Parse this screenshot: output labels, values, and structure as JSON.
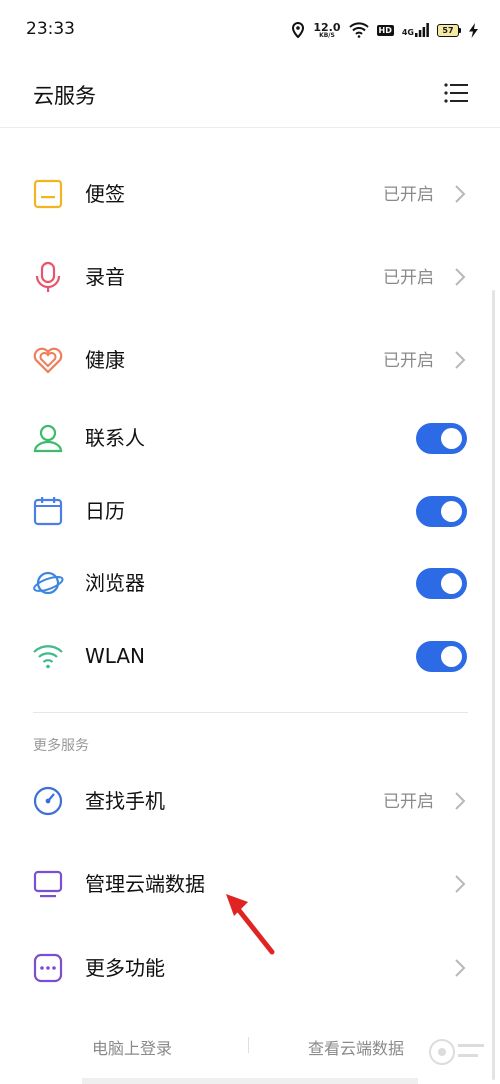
{
  "status_bar": {
    "time": "23:33",
    "net_speed_value": "12.0",
    "net_speed_unit": "KB/S",
    "hd_label": "HD",
    "network_label": "4G",
    "battery_level": "57"
  },
  "header": {
    "title": "云服务"
  },
  "items": [
    {
      "label": "便签",
      "status": "已开启",
      "icon": "note-icon",
      "control": "chevron"
    },
    {
      "label": "录音",
      "status": "已开启",
      "icon": "microphone-icon",
      "control": "chevron"
    },
    {
      "label": "健康",
      "status": "已开启",
      "icon": "heart-icon",
      "control": "chevron"
    },
    {
      "label": "联系人",
      "icon": "contact-icon",
      "control": "toggle",
      "toggle_on": true
    },
    {
      "label": "日历",
      "icon": "calendar-icon",
      "control": "toggle",
      "toggle_on": true
    },
    {
      "label": "浏览器",
      "icon": "browser-planet-icon",
      "control": "toggle",
      "toggle_on": true
    },
    {
      "label": "WLAN",
      "icon": "wifi-icon",
      "control": "toggle",
      "toggle_on": true
    }
  ],
  "more_services": {
    "section_label": "更多服务",
    "items": [
      {
        "label": "查找手机",
        "status": "已开启",
        "icon": "find-phone-compass-icon",
        "control": "chevron"
      },
      {
        "label": "管理云端数据",
        "icon": "monitor-icon",
        "control": "chevron"
      },
      {
        "label": "更多功能",
        "icon": "more-dots-icon",
        "control": "chevron"
      }
    ]
  },
  "footer": {
    "left_link": "电脑上登录",
    "right_link": "查看云端数据"
  },
  "colors": {
    "accent": "#2c6be5",
    "annotation_arrow": "#e02424",
    "status_text": "#8a8a8a"
  }
}
